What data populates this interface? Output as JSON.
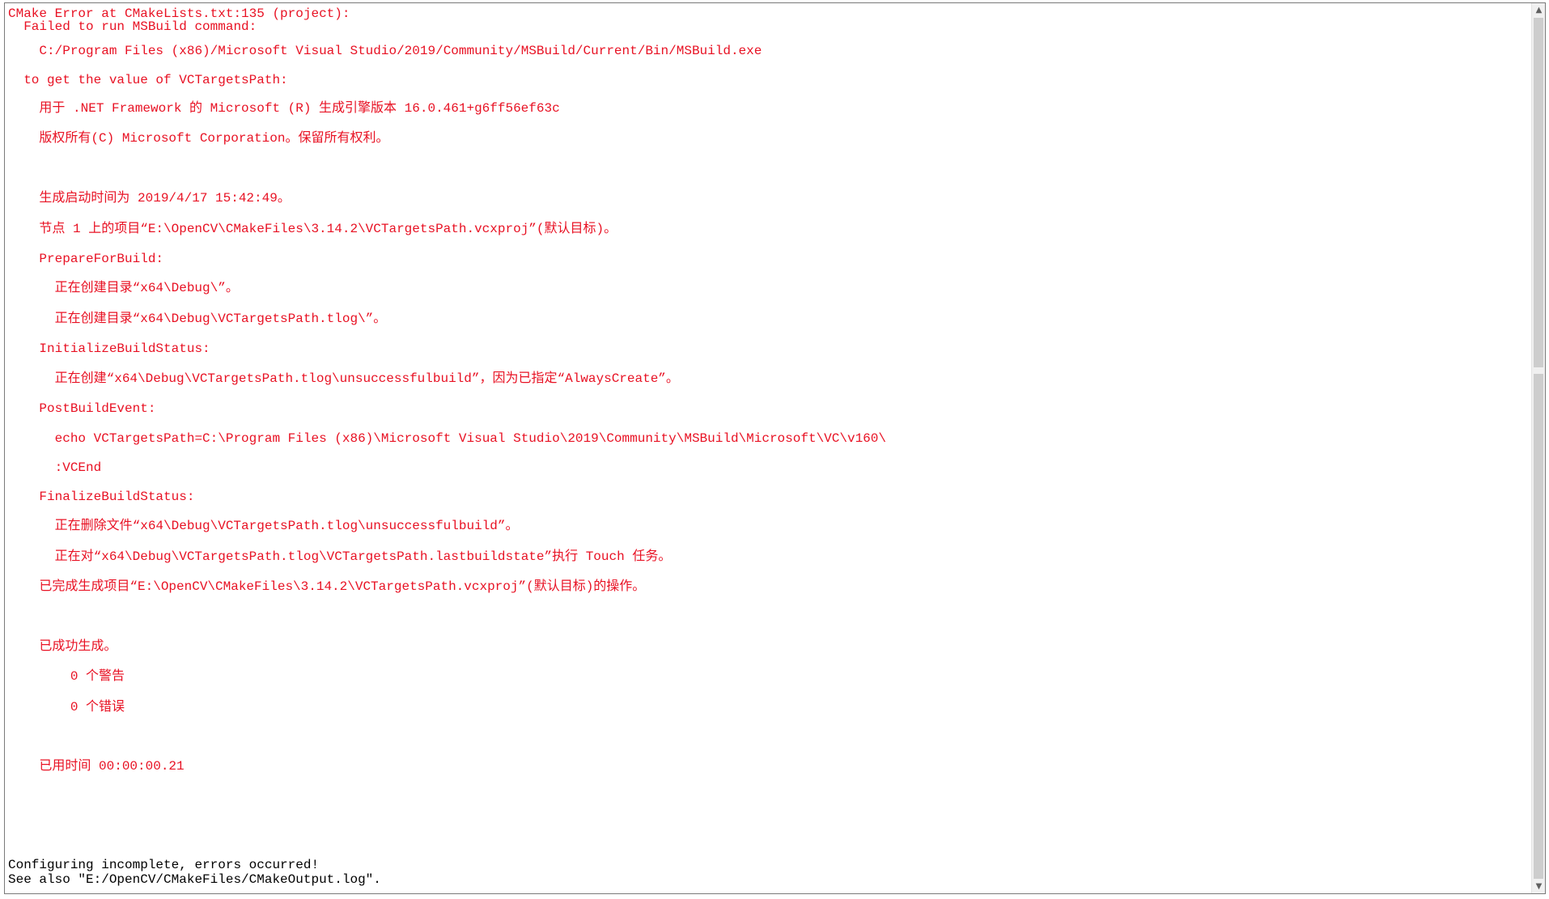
{
  "output": {
    "lines": [
      "CMake Error at CMakeLists.txt:135 (project):",
      "  Failed to run MSBuild command:",
      "    C:/Program Files (x86)/Microsoft Visual Studio/2019/Community/MSBuild/Current/Bin/MSBuild.exe",
      "  to get the value of VCTargetsPath:",
      "    用于 .NET Framework 的 Microsoft (R) 生成引擎版本 16.0.461+g6ff56ef63c",
      "    版权所有(C) Microsoft Corporation。保留所有权利。",
      "    生成启动时间为 2019/4/17 15:42:49。",
      "    节点 1 上的项目“E:\\OpenCV\\CMakeFiles\\3.14.2\\VCTargetsPath.vcxproj”(默认目标)。",
      "    PrepareForBuild:",
      "      正在创建目录“x64\\Debug\\”。",
      "      正在创建目录“x64\\Debug\\VCTargetsPath.tlog\\”。",
      "    InitializeBuildStatus:",
      "      正在创建“x64\\Debug\\VCTargetsPath.tlog\\unsuccessfulbuild”，因为已指定“AlwaysCreate”。",
      "    PostBuildEvent:",
      "      echo VCTargetsPath=C:\\Program Files (x86)\\Microsoft Visual Studio\\2019\\Community\\MSBuild\\Microsoft\\VC\\v160\\",
      "      :VCEnd",
      "    FinalizeBuildStatus:",
      "      正在删除文件“x64\\Debug\\VCTargetsPath.tlog\\unsuccessfulbuild”。",
      "      正在对“x64\\Debug\\VCTargetsPath.tlog\\VCTargetsPath.lastbuildstate”执行 Touch 任务。",
      "    已完成生成项目“E:\\OpenCV\\CMakeFiles\\3.14.2\\VCTargetsPath.vcxproj”(默认目标)的操作。",
      "    已成功生成。",
      "        0 个警告",
      "        0 个错误",
      "    已用时间 00:00:00.21",
      "Configuring incomplete, errors occurred!",
      "See also \"E:/OpenCV/CMakeFiles/CMakeOutput.log\"."
    ]
  },
  "scrollbar": {
    "up_icon": "▲",
    "down_icon": "▼"
  },
  "colors": {
    "error_text": "#e81123",
    "normal_text": "#000000"
  }
}
